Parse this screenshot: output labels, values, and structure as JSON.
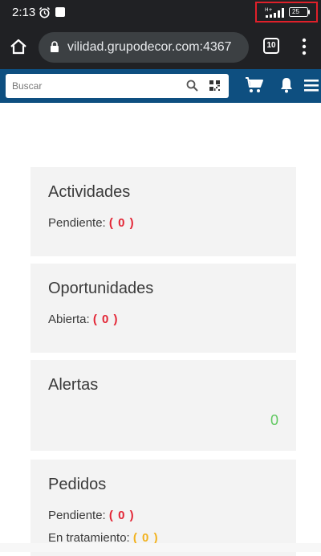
{
  "status_bar": {
    "time": "2:13",
    "battery_level": "25",
    "network_label": "H+"
  },
  "browser": {
    "url": "vilidad.grupodecor.com:4367",
    "tabs_count": "10"
  },
  "app_header": {
    "search_placeholder": "Buscar",
    "accent_color": "#0e4f80"
  },
  "cards": {
    "actividades": {
      "title": "Actividades",
      "lines": [
        {
          "label": "Pendiente:",
          "count": "( 0 )"
        }
      ]
    },
    "oportunidades": {
      "title": "Oportunidades",
      "lines": [
        {
          "label": "Abierta:",
          "count": "( 0 )"
        }
      ]
    },
    "alertas": {
      "title": "Alertas",
      "count": "0"
    },
    "pedidos": {
      "title": "Pedidos",
      "lines": [
        {
          "label": "Pendiente:",
          "count": "( 0 )"
        },
        {
          "label": "En tratamiento:",
          "count": "( 0 )"
        }
      ]
    }
  },
  "colors": {
    "count_red": "#e32636",
    "count_yellow": "#f2b21e",
    "count_green": "#5fc85f"
  }
}
